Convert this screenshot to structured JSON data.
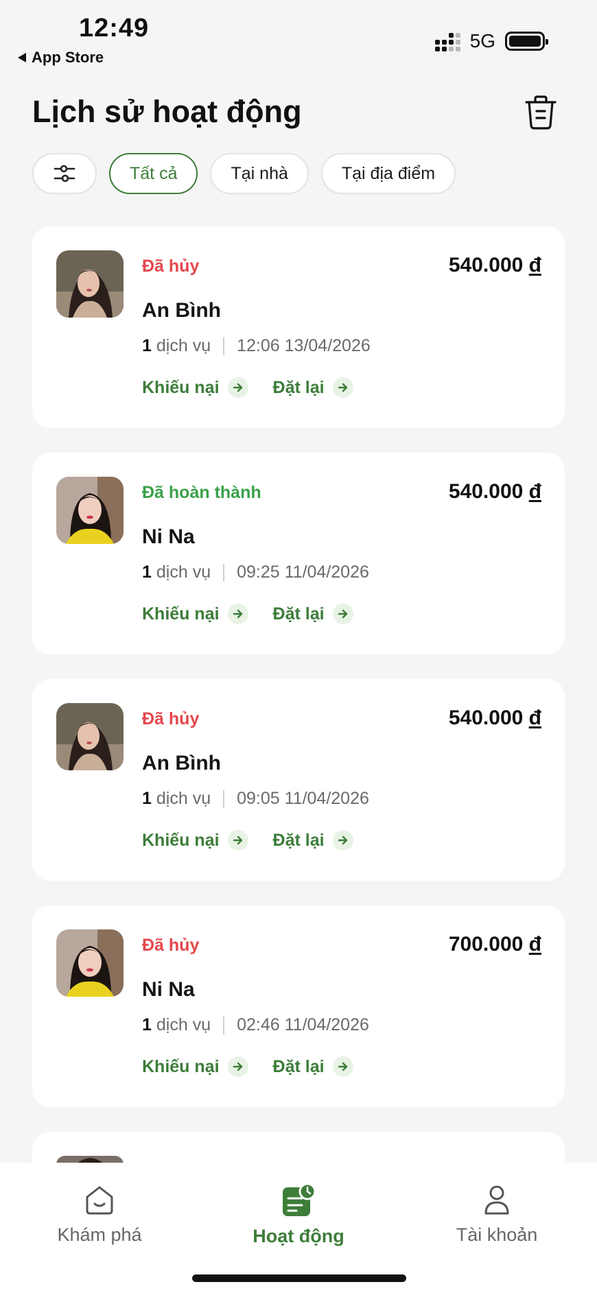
{
  "status_bar": {
    "time": "12:49",
    "back_label": "App Store",
    "network": "5G"
  },
  "header": {
    "title": "Lịch sử hoạt động",
    "delete_icon": "trash-icon"
  },
  "filters": {
    "filter_icon": "sliders-icon",
    "chips": [
      {
        "label": "Tất cả",
        "active": true
      },
      {
        "label": "Tại nhà",
        "active": false
      },
      {
        "label": "Tại địa điểm",
        "active": false
      }
    ]
  },
  "colors": {
    "accent": "#3d7d3a",
    "cancelled": "#e5484d",
    "completed": "#3aa14a"
  },
  "orders": [
    {
      "status": "Đã hủy",
      "status_type": "cancelled",
      "price": "540.000",
      "currency": "đ",
      "name": "An Bình",
      "service_count": "1",
      "service_label": "dịch vụ",
      "datetime": "12:06 13/04/2026",
      "complaint_label": "Khiếu nại",
      "rebook_label": "Đặt lại"
    },
    {
      "status": "Đã hoàn thành",
      "status_type": "completed",
      "price": "540.000",
      "currency": "đ",
      "name": "Ni Na",
      "service_count": "1",
      "service_label": "dịch vụ",
      "datetime": "09:25 11/04/2026",
      "complaint_label": "Khiếu nại",
      "rebook_label": "Đặt lại"
    },
    {
      "status": "Đã hủy",
      "status_type": "cancelled",
      "price": "540.000",
      "currency": "đ",
      "name": "An Bình",
      "service_count": "1",
      "service_label": "dịch vụ",
      "datetime": "09:05 11/04/2026",
      "complaint_label": "Khiếu nại",
      "rebook_label": "Đặt lại"
    },
    {
      "status": "Đã hủy",
      "status_type": "cancelled",
      "price": "700.000",
      "currency": "đ",
      "name": "Ni Na",
      "service_count": "1",
      "service_label": "dịch vụ",
      "datetime": "02:46 11/04/2026",
      "complaint_label": "Khiếu nại",
      "rebook_label": "Đặt lại"
    }
  ],
  "bottom_nav": [
    {
      "label": "Khám phá",
      "icon": "home-icon",
      "active": false
    },
    {
      "label": "Hoạt động",
      "icon": "activity-clock-icon",
      "active": true
    },
    {
      "label": "Tài khoản",
      "icon": "user-icon",
      "active": false
    }
  ]
}
